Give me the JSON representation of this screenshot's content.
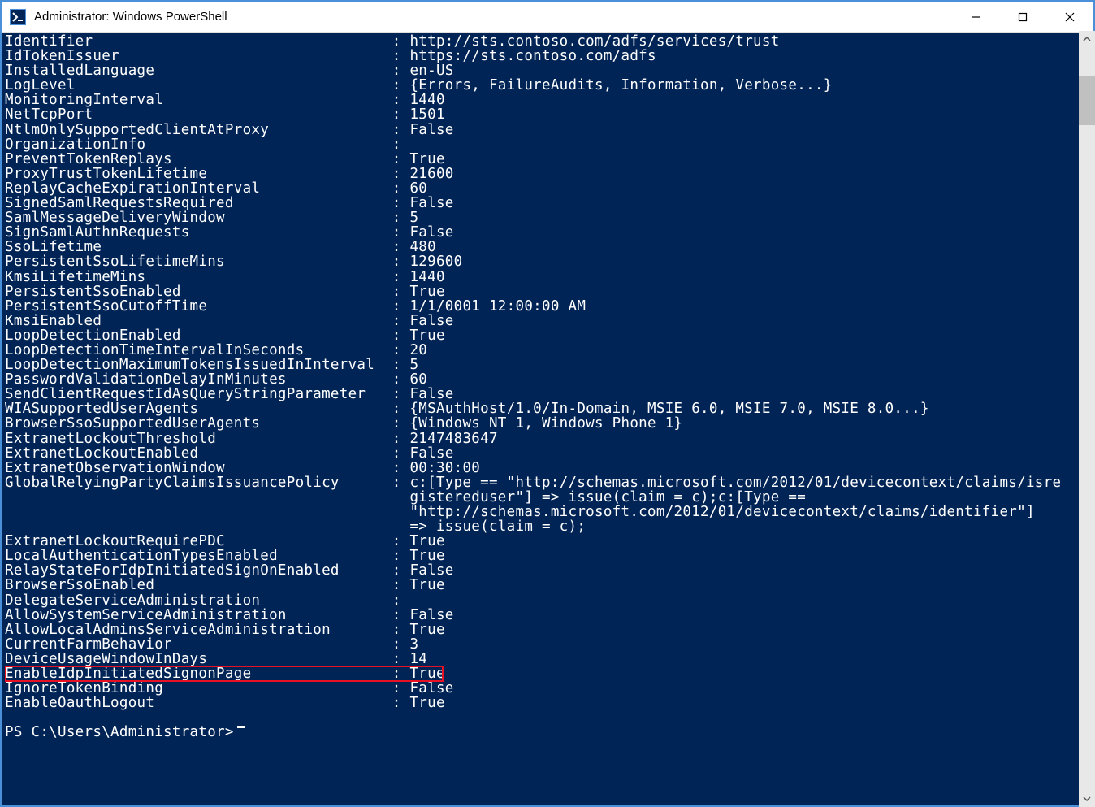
{
  "window": {
    "title": "Administrator: Windows PowerShell",
    "icon": "powershell-icon"
  },
  "colors": {
    "terminal_bg": "#012456",
    "terminal_fg": "#ffffff",
    "highlight_border": "#e81123"
  },
  "properties": [
    {
      "key": "Identifier",
      "value": "http://sts.contoso.com/adfs/services/trust"
    },
    {
      "key": "IdTokenIssuer",
      "value": "https://sts.contoso.com/adfs"
    },
    {
      "key": "InstalledLanguage",
      "value": "en-US"
    },
    {
      "key": "LogLevel",
      "value": "{Errors, FailureAudits, Information, Verbose...}"
    },
    {
      "key": "MonitoringInterval",
      "value": "1440"
    },
    {
      "key": "NetTcpPort",
      "value": "1501"
    },
    {
      "key": "NtlmOnlySupportedClientAtProxy",
      "value": "False"
    },
    {
      "key": "OrganizationInfo",
      "value": ""
    },
    {
      "key": "PreventTokenReplays",
      "value": "True"
    },
    {
      "key": "ProxyTrustTokenLifetime",
      "value": "21600"
    },
    {
      "key": "ReplayCacheExpirationInterval",
      "value": "60"
    },
    {
      "key": "SignedSamlRequestsRequired",
      "value": "False"
    },
    {
      "key": "SamlMessageDeliveryWindow",
      "value": "5"
    },
    {
      "key": "SignSamlAuthnRequests",
      "value": "False"
    },
    {
      "key": "SsoLifetime",
      "value": "480"
    },
    {
      "key": "PersistentSsoLifetimeMins",
      "value": "129600"
    },
    {
      "key": "KmsiLifetimeMins",
      "value": "1440"
    },
    {
      "key": "PersistentSsoEnabled",
      "value": "True"
    },
    {
      "key": "PersistentSsoCutoffTime",
      "value": "1/1/0001 12:00:00 AM"
    },
    {
      "key": "KmsiEnabled",
      "value": "False"
    },
    {
      "key": "LoopDetectionEnabled",
      "value": "True"
    },
    {
      "key": "LoopDetectionTimeIntervalInSeconds",
      "value": "20"
    },
    {
      "key": "LoopDetectionMaximumTokensIssuedInInterval",
      "value": "5"
    },
    {
      "key": "PasswordValidationDelayInMinutes",
      "value": "60"
    },
    {
      "key": "SendClientRequestIdAsQueryStringParameter",
      "value": "False"
    },
    {
      "key": "WIASupportedUserAgents",
      "value": "{MSAuthHost/1.0/In-Domain, MSIE 6.0, MSIE 7.0, MSIE 8.0...}"
    },
    {
      "key": "BrowserSsoSupportedUserAgents",
      "value": "{Windows NT 1, Windows Phone 1}"
    },
    {
      "key": "ExtranetLockoutThreshold",
      "value": "2147483647"
    },
    {
      "key": "ExtranetLockoutEnabled",
      "value": "False"
    },
    {
      "key": "ExtranetObservationWindow",
      "value": "00:30:00"
    },
    {
      "key": "GlobalRelyingPartyClaimsIssuancePolicy",
      "value": "c:[Type == \"http://schemas.microsoft.com/2012/01/devicecontext/claims/isre",
      "continuation": [
        "gistereduser\"] => issue(claim = c);c:[Type ==",
        "\"http://schemas.microsoft.com/2012/01/devicecontext/claims/identifier\"]",
        "=> issue(claim = c);"
      ]
    },
    {
      "key": "ExtranetLockoutRequirePDC",
      "value": "True"
    },
    {
      "key": "LocalAuthenticationTypesEnabled",
      "value": "True"
    },
    {
      "key": "RelayStateForIdpInitiatedSignOnEnabled",
      "value": "False"
    },
    {
      "key": "BrowserSsoEnabled",
      "value": "True"
    },
    {
      "key": "DelegateServiceAdministration",
      "value": ""
    },
    {
      "key": "AllowSystemServiceAdministration",
      "value": "False"
    },
    {
      "key": "AllowLocalAdminsServiceAdministration",
      "value": "True"
    },
    {
      "key": "CurrentFarmBehavior",
      "value": "3"
    },
    {
      "key": "DeviceUsageWindowInDays",
      "value": "14"
    },
    {
      "key": "EnableIdpInitiatedSignonPage",
      "value": "True",
      "highlighted": true
    },
    {
      "key": "IgnoreTokenBinding",
      "value": "False"
    },
    {
      "key": "EnableOauthLogout",
      "value": "True"
    }
  ],
  "prompt": "PS C:\\Users\\Administrator>",
  "highlight_row_index": 40
}
